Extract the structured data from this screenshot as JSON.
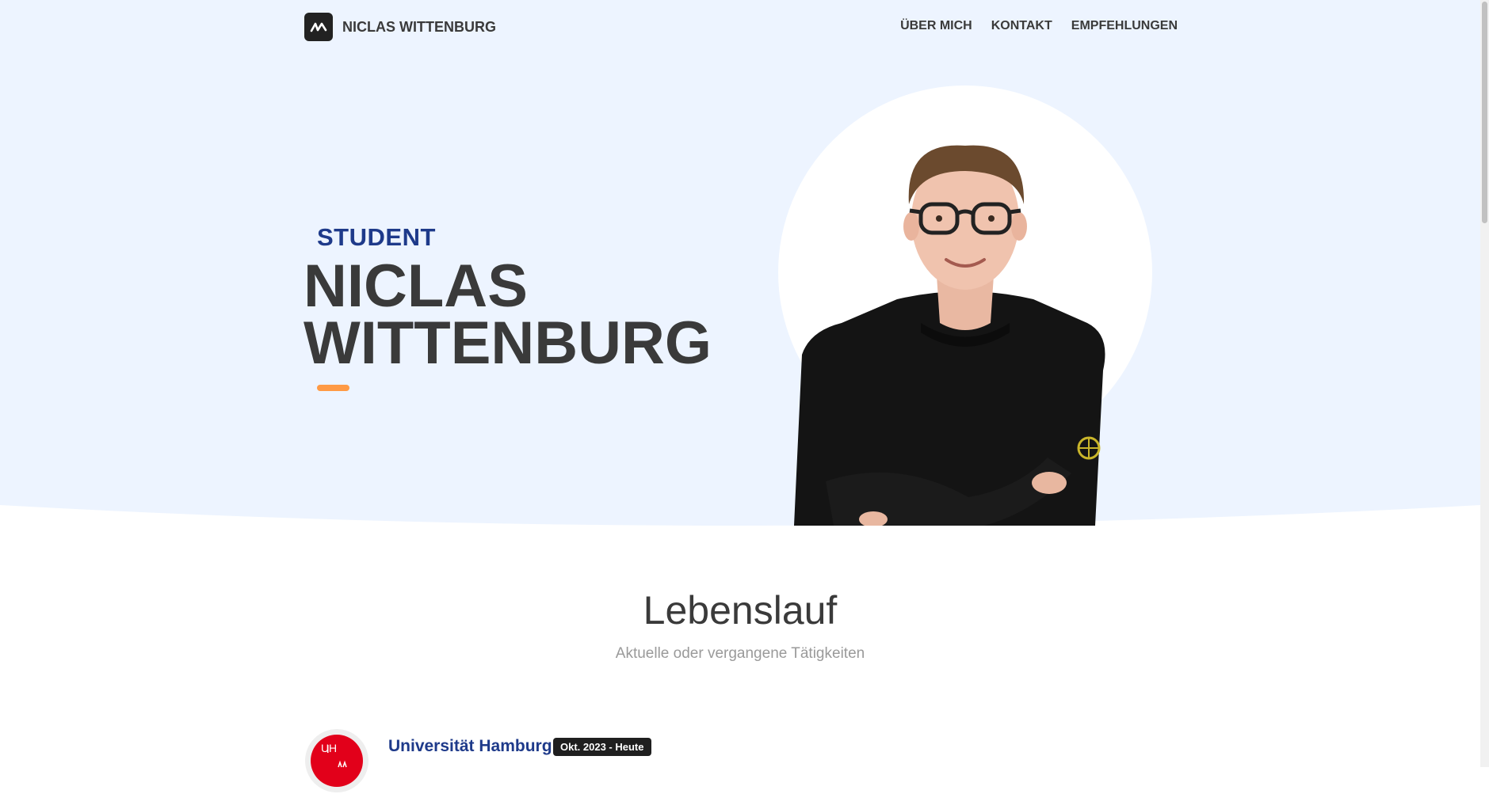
{
  "nav": {
    "brand_name": "NICLAS WITTENBURG",
    "logo_icon": "nw-monogram-icon",
    "items": [
      {
        "label": "ÜBER MICH"
      },
      {
        "label": "KONTAKT"
      },
      {
        "label": "EMPFEHLUNGEN"
      }
    ]
  },
  "hero": {
    "eyebrow": "STUDENT",
    "name_line1": "NICLAS",
    "name_line2": "WITTENBURG",
    "accent_color": "#ff9a45",
    "background_color": "#edf4ff"
  },
  "cv": {
    "title": "Lebenslauf",
    "subtitle": "Aktuelle oder vergangene Tätigkeiten",
    "entries": [
      {
        "institution": "Universität Hamburg",
        "period": "Okt. 2023 - Heute",
        "logo_text": "UH"
      }
    ]
  },
  "colors": {
    "heading_blue": "#1e3a8a",
    "text_dark": "#3a3a3a",
    "uni_red": "#e2001a"
  }
}
